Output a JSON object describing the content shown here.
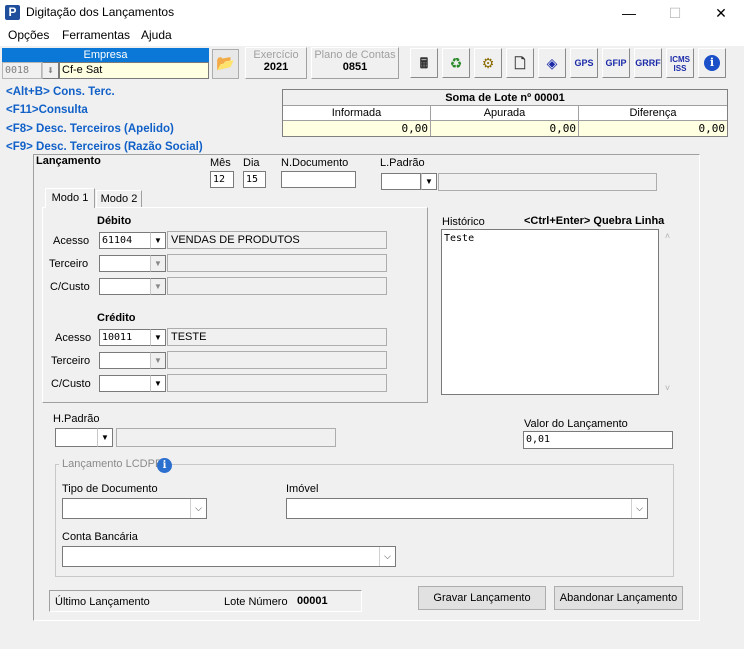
{
  "window": {
    "title": "Digitação dos Lançamentos",
    "app_icon_letter": "P"
  },
  "menu": {
    "items": [
      "Opções",
      "Ferramentas",
      "Ajuda"
    ]
  },
  "empresa": {
    "label": "Empresa",
    "code": "0018",
    "name": "Cf-e Sat"
  },
  "exercicio": {
    "label": "Exercício",
    "value": "2021"
  },
  "plano_contas": {
    "label": "Plano de Contas",
    "value": "0851"
  },
  "toolbar": {
    "icons": [
      "calculator-icon",
      "recycle-icon",
      "gear-doc-icon",
      "new-doc-icon",
      "target-icon",
      "gps-icon",
      "gfip-icon",
      "grrf-icon",
      "icms-iss-icon",
      "info-icon"
    ],
    "gps_label": "GPS",
    "gfip_label": "GFIP",
    "grrf_label": "GRRF",
    "icms_label": "ICMS",
    "iss_label": "ISS"
  },
  "shortcuts": [
    "<Alt+B> Cons. Terc.",
    "<F11>Consulta",
    "<F8> Desc. Terceiros (Apelido)",
    "<F9> Desc. Terceiros (Razão Social)"
  ],
  "soma": {
    "title": "Soma de Lote nº 00001",
    "columns": [
      "Informada",
      "Apurada",
      "Diferença"
    ],
    "values": [
      "0,00",
      "0,00",
      "0,00"
    ]
  },
  "lancamento": {
    "title": "Lançamento",
    "mes_label": "Mês",
    "mes": "12",
    "dia_label": "Dia",
    "dia": "15",
    "ndoc_label": "N.Documento",
    "ndoc": "",
    "lpadrao_label": "L.Padrão"
  },
  "tabs": [
    "Modo 1",
    "Modo 2"
  ],
  "debito": {
    "title": "Débito",
    "acesso_label": "Acesso",
    "acesso": "61104",
    "acesso_desc": "VENDAS DE PRODUTOS",
    "terceiro_label": "Terceiro",
    "ccusto_label": "C/Custo"
  },
  "credito": {
    "title": "Crédito",
    "acesso_label": "Acesso",
    "acesso": "10011",
    "acesso_desc": "TESTE",
    "terceiro_label": "Terceiro",
    "ccusto_label": "C/Custo"
  },
  "historico": {
    "label": "Histórico",
    "hint": "<Ctrl+Enter> Quebra Linha",
    "text": "Teste"
  },
  "hpadrao": {
    "label": "H.Padrão"
  },
  "valor": {
    "label": "Valor do Lançamento",
    "value": "0,01"
  },
  "lcdpr": {
    "title": "Lançamento LCDPR",
    "tipo_doc_label": "Tipo de Documento",
    "imovel_label": "Imóvel",
    "conta_label": "Conta Bancária"
  },
  "status": {
    "ultimo_label": "Último Lançamento",
    "lote_label": "Lote Número",
    "lote_value": "00001"
  },
  "buttons": {
    "gravar": "Gravar Lançamento",
    "abandonar": "Abandonar Lançamento"
  }
}
